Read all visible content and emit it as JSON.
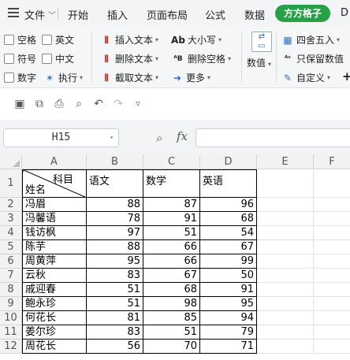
{
  "menu": {
    "file": "文件",
    "tabs": [
      "开始",
      "插入",
      "页面布局",
      "公式",
      "数据",
      "方方格子",
      "D"
    ],
    "active_tab": "方方格子",
    "active_color": "#27a047"
  },
  "ribbon": {
    "checkboxes": [
      "空格",
      "英文",
      "符号",
      "中文",
      "数字"
    ],
    "execute": "执行",
    "group2": [
      "插入文本",
      "删除文本",
      "截取文本"
    ],
    "group3": [
      "大小写",
      "删除空格",
      "更多"
    ],
    "numeric_label": "数值",
    "group5": [
      "四舍五入",
      "只保留数值",
      "自定义"
    ],
    "plus": "+"
  },
  "quick_access": [
    "save-icon",
    "save-as-icon",
    "print-icon",
    "print-preview-icon",
    "undo-icon",
    "redo-icon",
    "customize-icon"
  ],
  "formula_bar": {
    "cell_ref": "H15",
    "fx": "fx",
    "value": ""
  },
  "sheet": {
    "columns": [
      "A",
      "B",
      "C",
      "D",
      "E",
      "F"
    ],
    "rows": [
      "1",
      "2",
      "3",
      "4",
      "5",
      "6",
      "7",
      "8",
      "9",
      "10",
      "11",
      "12"
    ],
    "header_diag_top": "科目",
    "header_diag_bottom": "姓名",
    "headers": [
      "语文",
      "数学",
      "英语"
    ],
    "data": [
      [
        "冯眉",
        "88",
        "87",
        "96"
      ],
      [
        "冯馨语",
        "78",
        "91",
        "68"
      ],
      [
        "钱访枫",
        "97",
        "51",
        "54"
      ],
      [
        "陈芋",
        "88",
        "66",
        "67"
      ],
      [
        "周黄萍",
        "95",
        "66",
        "99"
      ],
      [
        "云秋",
        "83",
        "67",
        "50"
      ],
      [
        "戚迎春",
        "51",
        "68",
        "91"
      ],
      [
        "鲍永珍",
        "51",
        "98",
        "95"
      ],
      [
        "何花长",
        "81",
        "85",
        "94"
      ],
      [
        "姜尔珍",
        "83",
        "51",
        "79"
      ],
      [
        "周花长",
        "56",
        "70",
        "71"
      ]
    ]
  }
}
